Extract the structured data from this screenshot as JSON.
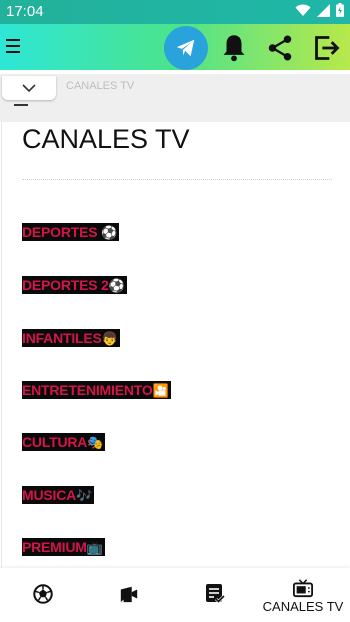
{
  "status_bar": {
    "time": "17:04",
    "icons": [
      "wifi-icon",
      "signal-icon",
      "battery-icon"
    ]
  },
  "app_bar": {
    "icons": [
      "menu-icon",
      "telegram-icon",
      "bell-icon",
      "share-icon",
      "exit-icon"
    ],
    "colors": {
      "gradient_start": "#2ee6d6",
      "gradient_mid": "#4be38c",
      "gradient_end": "#b8e84b",
      "telegram_blue": "#2aa3dd"
    }
  },
  "breadcrumb": "CANALES TV",
  "page": {
    "title": "CANALES TV",
    "categories": [
      {
        "label": " DEPORTES ",
        "emoji": "⚽"
      },
      {
        "label": "DEPORTES 2",
        "emoji": "⚽"
      },
      {
        "label": "INFANTILES",
        "emoji": "👦"
      },
      {
        "label": "ENTRETENIMIENTO",
        "emoji": "🎦"
      },
      {
        "label": "CULTURA",
        "emoji": "🎭"
      },
      {
        "label": "MUSICA",
        "emoji": "🎶"
      },
      {
        "label": "PREMIUM",
        "emoji": "📺"
      }
    ],
    "category_colors": {
      "text": "#d4144a",
      "background": "#0a0a0a"
    }
  },
  "bottom_nav": {
    "items": [
      {
        "icon": "soccer-ball-icon",
        "label": ""
      },
      {
        "icon": "video-camera-icon",
        "label": ""
      },
      {
        "icon": "checklist-icon",
        "label": ""
      },
      {
        "icon": "tv-icon",
        "label": "CANALES TV"
      }
    ],
    "active_index": 3
  }
}
